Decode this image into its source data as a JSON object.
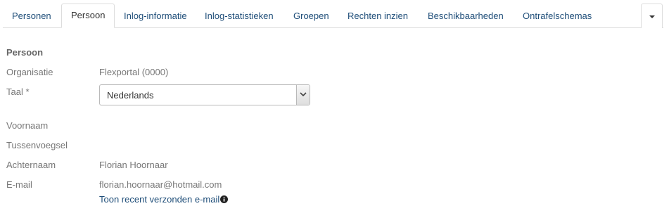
{
  "tabs": [
    {
      "label": "Personen",
      "active": false
    },
    {
      "label": "Persoon",
      "active": true
    },
    {
      "label": "Inlog-informatie",
      "active": false
    },
    {
      "label": "Inlog-statistieken",
      "active": false
    },
    {
      "label": "Groepen",
      "active": false
    },
    {
      "label": "Rechten inzien",
      "active": false
    },
    {
      "label": "Beschikbaarheden",
      "active": false
    },
    {
      "label": "Ontrafelschemas",
      "active": false
    }
  ],
  "section": {
    "title": "Persoon"
  },
  "fields": {
    "organisatie": {
      "label": "Organisatie",
      "value": "Flexportal (0000)"
    },
    "taal": {
      "label": "Taal *",
      "value": "Nederlands"
    },
    "voornaam": {
      "label": "Voornaam",
      "value": ""
    },
    "tussenvoegsel": {
      "label": "Tussenvoegsel",
      "value": ""
    },
    "achternaam": {
      "label": "Achternaam",
      "value": "Florian Hoornaar"
    },
    "email": {
      "label": "E-mail",
      "value": "florian.hoornaar@hotmail.com"
    }
  },
  "links": {
    "recent_email": "Toon recent verzonden e-mail"
  },
  "icons": {
    "tab_menu": "caret-down-icon",
    "select_arrow": "chevron-down-icon",
    "info": "info-circle-icon"
  },
  "colors": {
    "link": "#1f4e79",
    "label": "#777777",
    "border": "#dddddd"
  }
}
